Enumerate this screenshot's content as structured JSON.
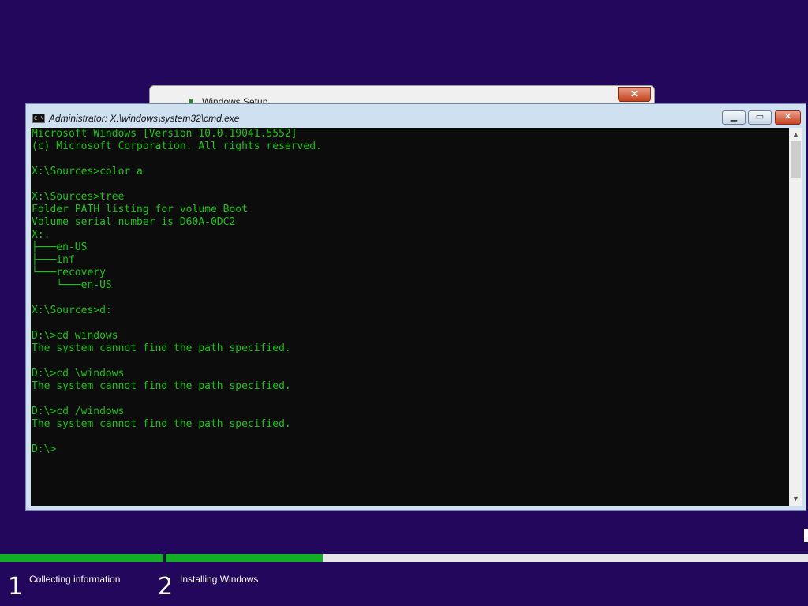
{
  "setup_window": {
    "title": "Windows Setup",
    "close_label": "✕"
  },
  "cmd_window": {
    "title": "Administrator: X:\\windows\\system32\\cmd.exe",
    "icon_label": "C:\\",
    "minimize_label": "▁",
    "maximize_label": "▭",
    "close_label": "✕",
    "text_color": "#16c60c",
    "background_color": "#0c0c0c",
    "lines": [
      "Microsoft Windows [Version 10.0.19041.5552]",
      "(c) Microsoft Corporation. All rights reserved.",
      "",
      "X:\\Sources>color a",
      "",
      "X:\\Sources>tree",
      "Folder PATH listing for volume Boot",
      "Volume serial number is D60A-0DC2",
      "X:.",
      "├───en-US",
      "├───inf",
      "└───recovery",
      "    └───en-US",
      "",
      "X:\\Sources>d:",
      "",
      "D:\\>cd windows",
      "The system cannot find the path specified.",
      "",
      "D:\\>cd \\windows",
      "The system cannot find the path specified.",
      "",
      "D:\\>cd /windows",
      "The system cannot find the path specified.",
      "",
      "D:\\>"
    ],
    "scroll_up_icon": "▲",
    "scroll_down_icon": "▼"
  },
  "progress": {
    "accent_color": "#11b022",
    "steps": [
      {
        "number": "1",
        "label": "Collecting information",
        "progress": 1.0
      },
      {
        "number": "2",
        "label": "Installing Windows",
        "progress": 0.245
      }
    ]
  }
}
